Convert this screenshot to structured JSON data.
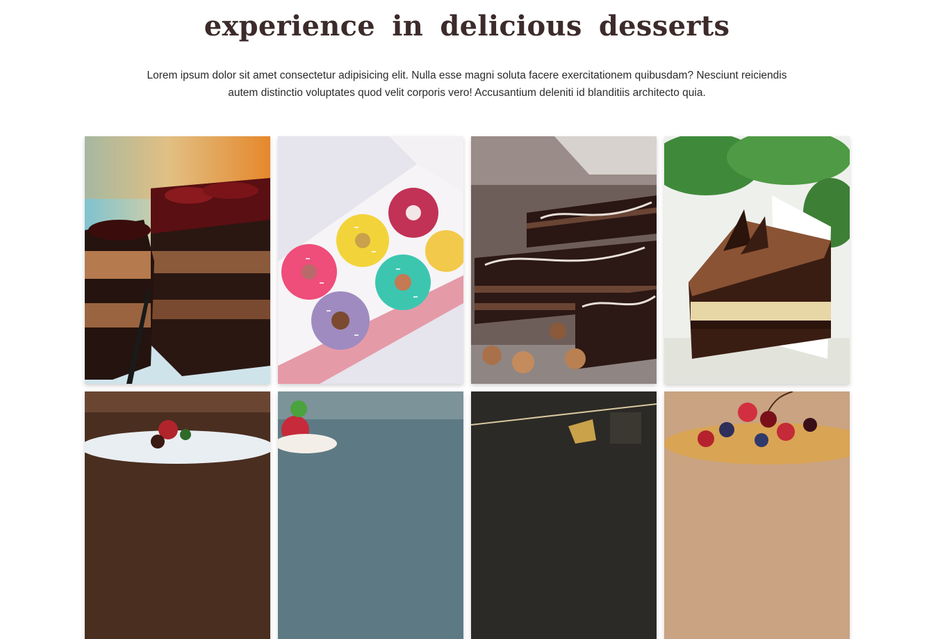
{
  "section": {
    "heading": "experience in delicious desserts",
    "intro": "Lorem ipsum dolor sit amet consectetur adipisicing elit. Nulla esse magni soluta facere exercitationem quibusdam? Nesciunt reiciendis autem distinctio voluptates quod velit corporis vero! Accusantium deleniti id blanditiis architecto quia."
  },
  "gallery": {
    "images": [
      {
        "name": "chocolate-cake-slice-image",
        "alt": "chocolate cake slice with cherry glaze"
      },
      {
        "name": "donut-box-image",
        "alt": "box of colorful sprinkle donuts"
      },
      {
        "name": "opera-cake-image",
        "alt": "chocolate opera cake with hazelnuts"
      },
      {
        "name": "tiramisu-slice-image",
        "alt": "cocoa layered cake slice"
      },
      {
        "name": "cream-tart-image",
        "alt": "cream tart with strawberries"
      },
      {
        "name": "strawberry-cupcake-image",
        "alt": "strawberry topped dessert"
      },
      {
        "name": "dark-dessert-image",
        "alt": "dessert in dark setting"
      },
      {
        "name": "berry-tart-image",
        "alt": "berry tart with cherries"
      }
    ]
  },
  "colors": {
    "heading": "#3d2b2b",
    "text": "#2a2a2a",
    "background": "#ffffff"
  }
}
